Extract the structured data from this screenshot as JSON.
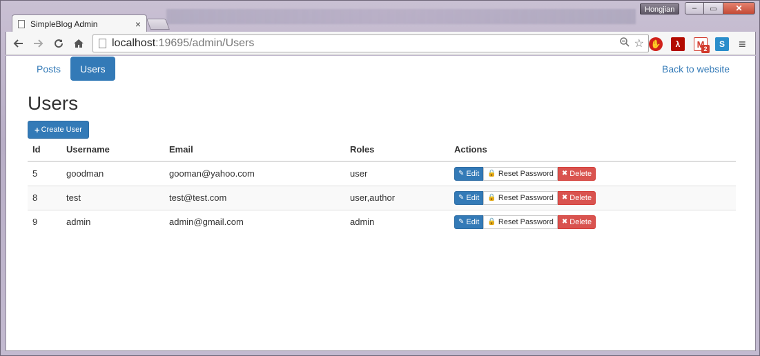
{
  "window": {
    "user_name": "Hongjian",
    "minimize": "–",
    "maximize": "▭",
    "close": "✕"
  },
  "browser": {
    "tab_title": "SimpleBlog Admin",
    "tab_close": "×",
    "url_host": "localhost",
    "url_rest": ":19695/admin/Users",
    "gmail_count": "2",
    "icons": {
      "back": "back-arrow-icon",
      "forward": "forward-arrow-icon",
      "reload": "reload-icon",
      "home": "home-icon",
      "zoom": "zoom-icon",
      "star": "star-icon",
      "adblock": "adblock-icon",
      "acrobat": "acrobat-icon",
      "gmail": "gmail-icon",
      "s_ext": "s-extension-icon",
      "menu": "hamburger-menu-icon"
    }
  },
  "nav": {
    "tabs": [
      {
        "label": "Posts",
        "active": false
      },
      {
        "label": "Users",
        "active": true
      }
    ],
    "back_link": "Back to website"
  },
  "page": {
    "title": "Users",
    "create_button": "Create User"
  },
  "table": {
    "headers": [
      "Id",
      "Username",
      "Email",
      "Roles",
      "Actions"
    ],
    "rows": [
      {
        "id": "5",
        "username": "goodman",
        "email": "gooman@yahoo.com",
        "roles": "user"
      },
      {
        "id": "8",
        "username": "test",
        "email": "test@test.com",
        "roles": "user,author"
      },
      {
        "id": "9",
        "username": "admin",
        "email": "admin@gmail.com",
        "roles": "admin"
      }
    ],
    "actions": {
      "edit": "Edit",
      "reset": "Reset Password",
      "delete": "Delete"
    }
  },
  "colors": {
    "primary": "#337ab7",
    "danger": "#d9534f"
  }
}
